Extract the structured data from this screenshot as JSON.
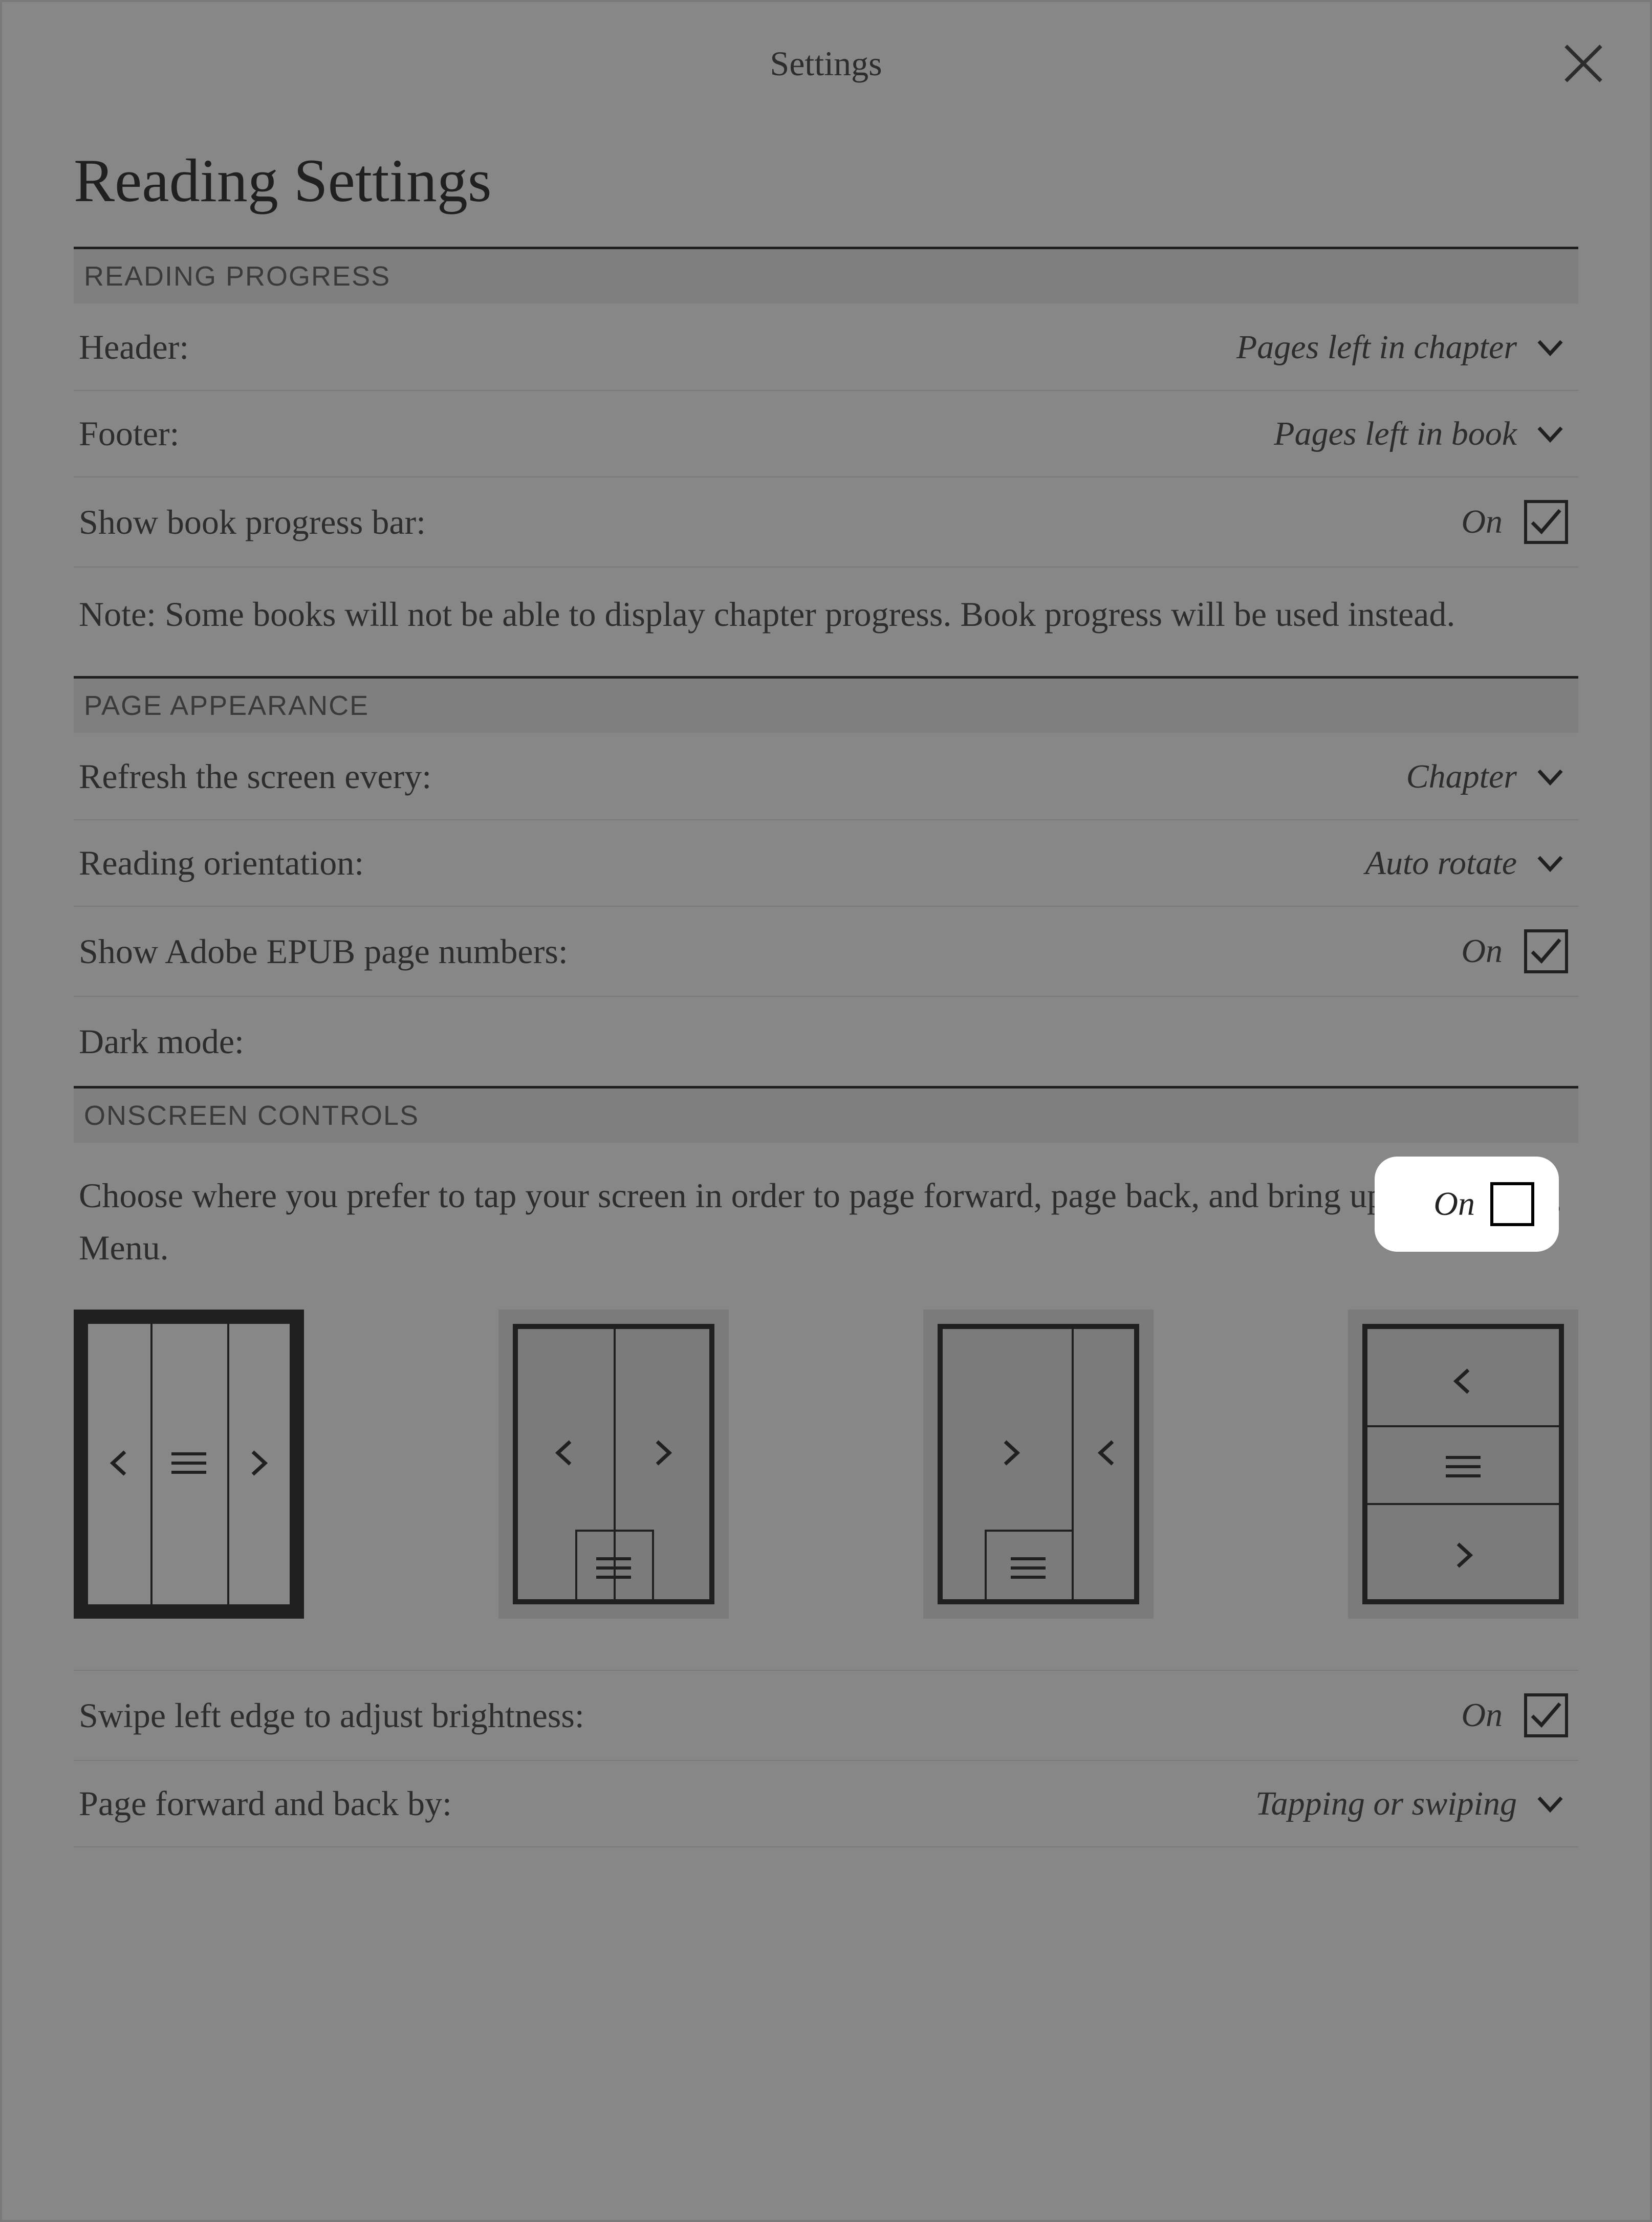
{
  "topbar": {
    "title": "Settings"
  },
  "page_title": "Reading Settings",
  "reading_progress": {
    "header": "READING PROGRESS",
    "header_row": {
      "label": "Header:",
      "value": "Pages left in chapter"
    },
    "footer_row": {
      "label": "Footer:",
      "value": "Pages left in book"
    },
    "progress_bar": {
      "label": "Show book progress bar:",
      "value": "On",
      "checked": true
    },
    "note": "Note: Some books will not be able to display chapter progress. Book progress will be used instead."
  },
  "page_appearance": {
    "header": "PAGE APPEARANCE",
    "refresh": {
      "label": "Refresh the screen every:",
      "value": "Chapter"
    },
    "orientation": {
      "label": "Reading orientation:",
      "value": "Auto rotate"
    },
    "adobe": {
      "label": "Show Adobe EPUB page numbers:",
      "value": "On",
      "checked": true
    },
    "dark_mode": {
      "label": "Dark mode:",
      "value": "On",
      "checked": false
    }
  },
  "onscreen": {
    "header": "ONSCREEN CONTROLS",
    "instruction": "Choose where you prefer to tap your screen in order to page forward, page back, and bring up the Reading Menu.",
    "swipe_brightness": {
      "label": "Swipe left edge to adjust brightness:",
      "value": "On",
      "checked": true
    },
    "page_forward": {
      "label": "Page forward and back by:",
      "value": "Tapping or swiping"
    }
  }
}
